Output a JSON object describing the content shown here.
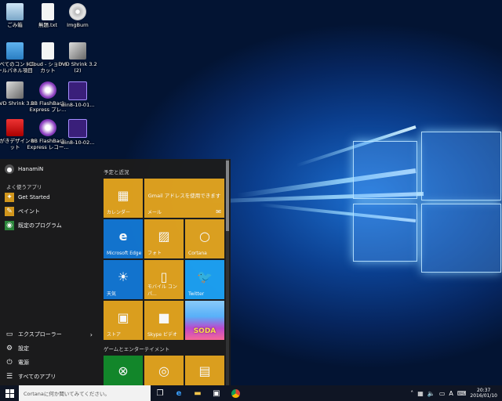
{
  "desktop": {
    "icons": [
      {
        "label": "ごみ箱",
        "icon": "recycle-bin-icon"
      },
      {
        "label": "無題.txt",
        "icon": "text-file-icon"
      },
      {
        "label": "ImgBurn",
        "icon": "disc-icon"
      },
      {
        "label": "すべてのコントロールパネル項目",
        "icon": "control-panel-icon"
      },
      {
        "label": "iCloud - ショートカット",
        "icon": "file-icon"
      },
      {
        "label": "DVD Shrink 3.2 (2)",
        "icon": "dvd-shrink-icon"
      },
      {
        "label": "DVD Shrink 3.2",
        "icon": "dvd-shrink-icon"
      },
      {
        "label": "BB FlashBack Express プレ...",
        "icon": "flashback-icon"
      },
      {
        "label": "win8-10-01...",
        "icon": "video-file-icon"
      },
      {
        "label": "はがきデザインキット",
        "icon": "hagaki-icon"
      },
      {
        "label": "BB FlashBack Express レコー...",
        "icon": "flashback-icon"
      },
      {
        "label": "win8-10-02...",
        "icon": "video-file-icon"
      }
    ]
  },
  "start": {
    "user": "HanamiN",
    "frequent_header": "よく使うアプリ",
    "frequent": [
      {
        "label": "Get Started",
        "icon": "lightbulb-icon"
      },
      {
        "label": "ペイント",
        "icon": "paint-icon"
      },
      {
        "label": "既定のプログラム",
        "icon": "default-programs-icon"
      }
    ],
    "bottom": [
      {
        "label": "エクスプローラー",
        "icon": "folder-icon",
        "chevron": "›"
      },
      {
        "label": "設定",
        "icon": "gear-icon"
      },
      {
        "label": "電源",
        "icon": "power-icon"
      },
      {
        "label": "すべてのアプリ",
        "icon": "list-icon"
      }
    ],
    "section1": "予定と近況",
    "section2": "ゲームとエンターテイメント",
    "tiles": {
      "calendar": "カレンダー",
      "mail_text": "Gmail アドレスを使用できます",
      "mail": "メール",
      "edge": "Microsoft Edge",
      "photos": "フォト",
      "cortana": "Cortana",
      "weather": "天気",
      "mobile": "モバイル コンパ...",
      "twitter": "Twitter",
      "store": "ストア",
      "skype": "Skype ビデオ",
      "candy": "SODA"
    }
  },
  "taskbar": {
    "search_placeholder": "Cortanaに何か聞いてみてください。",
    "ime": "A",
    "time": "20:37",
    "date": "2016/01/10"
  }
}
